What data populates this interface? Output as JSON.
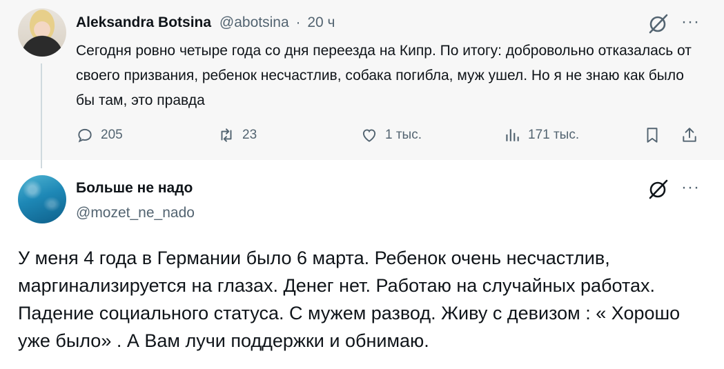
{
  "parent_tweet": {
    "author_name": "Aleksandra Botsina",
    "handle": "@abotsina",
    "separator": "·",
    "time": "20 ч",
    "text": "Сегодня ровно четыре года со дня переезда на Кипр. По итогу: добровольно отказалась от своего призвания, ребенок несчастлив, собака погибла, муж ушел. Но я не знаю как было бы там, это правда",
    "actions": {
      "replies": "205",
      "reposts": "23",
      "likes": "1 тыс.",
      "views": "171 тыс."
    },
    "icons": [
      "grok-icon",
      "more-icon",
      "reply-icon",
      "repost-icon",
      "like-icon",
      "views-icon",
      "bookmark-icon",
      "share-icon"
    ]
  },
  "reply_tweet": {
    "author_name": "Больше не надо",
    "handle": "@mozet_ne_nado",
    "text": "У меня 4 года в Германии было 6 марта. Ребенок очень несчастлив, маргинализируется на глазах. Денег нет. Работаю на случайных работах. Падение социального статуса. С мужем развод. Живу с девизом : « Хорошо уже было» . А Вам лучи поддержки и обнимаю.",
    "icons": [
      "grok-icon",
      "more-icon"
    ]
  },
  "colors": {
    "text": "#0f1419",
    "muted": "#536471",
    "parent_bg": "#f7f7f7",
    "thread_line": "#cfd9de"
  },
  "more_glyph": "···"
}
